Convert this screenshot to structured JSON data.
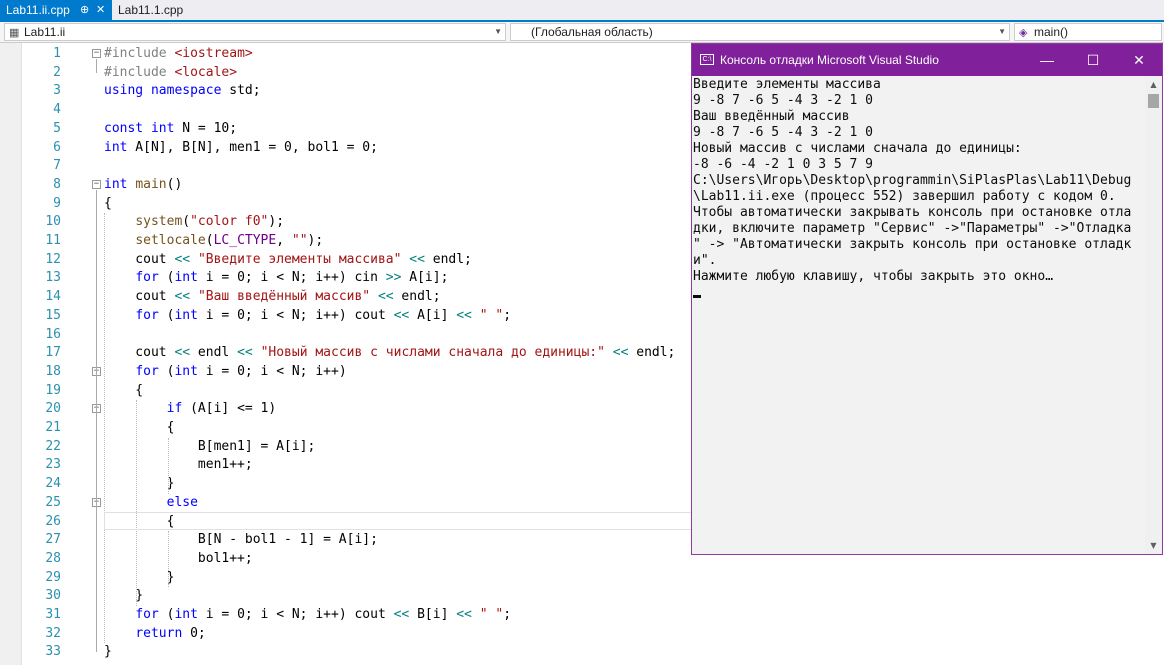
{
  "tabs": [
    {
      "label": "Lab11.ii.cpp",
      "active": true
    },
    {
      "label": "Lab11.1.cpp",
      "active": false
    }
  ],
  "tab_icons": {
    "pin": "⊕",
    "close": "✕"
  },
  "navbar": {
    "project": "Lab11.ii",
    "scope": "(Глобальная область)",
    "member": "main()"
  },
  "code_lines": [
    {
      "n": "1",
      "tokens": [
        [
          "pp",
          "#include "
        ],
        [
          "str",
          "<iostream>"
        ]
      ]
    },
    {
      "n": "2",
      "tokens": [
        [
          "pp",
          "#include "
        ],
        [
          "str",
          "<locale>"
        ]
      ]
    },
    {
      "n": "3",
      "tokens": [
        [
          "kw",
          "using"
        ],
        [
          "plain",
          " "
        ],
        [
          "kw",
          "namespace"
        ],
        [
          "plain",
          " std;"
        ]
      ]
    },
    {
      "n": "4",
      "tokens": []
    },
    {
      "n": "5",
      "tokens": [
        [
          "kw",
          "const"
        ],
        [
          "plain",
          " "
        ],
        [
          "kw",
          "int"
        ],
        [
          "plain",
          " N = 10;"
        ]
      ]
    },
    {
      "n": "6",
      "tokens": [
        [
          "kw",
          "int"
        ],
        [
          "plain",
          " A[N], B[N], men1 = 0, bol1 = 0;"
        ]
      ]
    },
    {
      "n": "7",
      "tokens": []
    },
    {
      "n": "8",
      "tokens": [
        [
          "kw",
          "int"
        ],
        [
          "plain",
          " "
        ],
        [
          "fn",
          "main"
        ],
        [
          "plain",
          "()"
        ]
      ]
    },
    {
      "n": "9",
      "tokens": [
        [
          "plain",
          "{"
        ]
      ]
    },
    {
      "n": "10",
      "tokens": [
        [
          "plain",
          "    "
        ],
        [
          "fn",
          "system"
        ],
        [
          "plain",
          "("
        ],
        [
          "str",
          "\"color f0\""
        ],
        [
          "plain",
          ");"
        ]
      ]
    },
    {
      "n": "11",
      "tokens": [
        [
          "plain",
          "    "
        ],
        [
          "fn",
          "setlocale"
        ],
        [
          "plain",
          "("
        ],
        [
          "mac",
          "LC_CTYPE"
        ],
        [
          "plain",
          ", "
        ],
        [
          "str",
          "\"\""
        ],
        [
          "plain",
          ");"
        ]
      ]
    },
    {
      "n": "12",
      "tokens": [
        [
          "plain",
          "    cout "
        ],
        [
          "op",
          "<<"
        ],
        [
          "plain",
          " "
        ],
        [
          "str",
          "\"Введите элементы массива\""
        ],
        [
          "plain",
          " "
        ],
        [
          "op",
          "<<"
        ],
        [
          "plain",
          " endl;"
        ]
      ]
    },
    {
      "n": "13",
      "tokens": [
        [
          "plain",
          "    "
        ],
        [
          "kw",
          "for"
        ],
        [
          "plain",
          " ("
        ],
        [
          "kw",
          "int"
        ],
        [
          "plain",
          " i = 0; i < N; i++) cin "
        ],
        [
          "op",
          ">>"
        ],
        [
          "plain",
          " A[i];"
        ]
      ]
    },
    {
      "n": "14",
      "tokens": [
        [
          "plain",
          "    cout "
        ],
        [
          "op",
          "<<"
        ],
        [
          "plain",
          " "
        ],
        [
          "str",
          "\"Ваш введённый массив\""
        ],
        [
          "plain",
          " "
        ],
        [
          "op",
          "<<"
        ],
        [
          "plain",
          " endl;"
        ]
      ]
    },
    {
      "n": "15",
      "tokens": [
        [
          "plain",
          "    "
        ],
        [
          "kw",
          "for"
        ],
        [
          "plain",
          " ("
        ],
        [
          "kw",
          "int"
        ],
        [
          "plain",
          " i = 0; i < N; i++) cout "
        ],
        [
          "op",
          "<<"
        ],
        [
          "plain",
          " A[i] "
        ],
        [
          "op",
          "<<"
        ],
        [
          "plain",
          " "
        ],
        [
          "str",
          "\" \""
        ],
        [
          "plain",
          ";"
        ]
      ]
    },
    {
      "n": "16",
      "tokens": []
    },
    {
      "n": "17",
      "tokens": [
        [
          "plain",
          "    cout "
        ],
        [
          "op",
          "<<"
        ],
        [
          "plain",
          " endl "
        ],
        [
          "op",
          "<<"
        ],
        [
          "plain",
          " "
        ],
        [
          "str",
          "\"Новый массив с числами сначала до единицы:\""
        ],
        [
          "plain",
          " "
        ],
        [
          "op",
          "<<"
        ],
        [
          "plain",
          " endl;"
        ]
      ]
    },
    {
      "n": "18",
      "tokens": [
        [
          "plain",
          "    "
        ],
        [
          "kw",
          "for"
        ],
        [
          "plain",
          " ("
        ],
        [
          "kw",
          "int"
        ],
        [
          "plain",
          " i = 0; i < N; i++)"
        ]
      ]
    },
    {
      "n": "19",
      "tokens": [
        [
          "plain",
          "    {"
        ]
      ]
    },
    {
      "n": "20",
      "tokens": [
        [
          "plain",
          "        "
        ],
        [
          "kw",
          "if"
        ],
        [
          "plain",
          " (A[i] <= 1)"
        ]
      ]
    },
    {
      "n": "21",
      "tokens": [
        [
          "plain",
          "        {"
        ]
      ]
    },
    {
      "n": "22",
      "tokens": [
        [
          "plain",
          "            B[men1] = A[i];"
        ]
      ]
    },
    {
      "n": "23",
      "tokens": [
        [
          "plain",
          "            men1++;"
        ]
      ]
    },
    {
      "n": "24",
      "tokens": [
        [
          "plain",
          "        }"
        ]
      ]
    },
    {
      "n": "25",
      "tokens": [
        [
          "plain",
          "        "
        ],
        [
          "kw",
          "else"
        ]
      ]
    },
    {
      "n": "26",
      "tokens": [
        [
          "plain",
          "        {"
        ]
      ]
    },
    {
      "n": "27",
      "tokens": [
        [
          "plain",
          "            B[N - bol1 - 1] = A[i];"
        ]
      ]
    },
    {
      "n": "28",
      "tokens": [
        [
          "plain",
          "            bol1++;"
        ]
      ]
    },
    {
      "n": "29",
      "tokens": [
        [
          "plain",
          "        }"
        ]
      ]
    },
    {
      "n": "30",
      "tokens": [
        [
          "plain",
          "    }"
        ]
      ]
    },
    {
      "n": "31",
      "tokens": [
        [
          "plain",
          "    "
        ],
        [
          "kw",
          "for"
        ],
        [
          "plain",
          " ("
        ],
        [
          "kw",
          "int"
        ],
        [
          "plain",
          " i = 0; i < N; i++) cout "
        ],
        [
          "op",
          "<<"
        ],
        [
          "plain",
          " B[i] "
        ],
        [
          "op",
          "<<"
        ],
        [
          "plain",
          " "
        ],
        [
          "str",
          "\" \""
        ],
        [
          "plain",
          ";"
        ]
      ]
    },
    {
      "n": "32",
      "tokens": [
        [
          "plain",
          "    "
        ],
        [
          "kw",
          "return"
        ],
        [
          "plain",
          " 0;"
        ]
      ]
    },
    {
      "n": "33",
      "tokens": [
        [
          "plain",
          "}"
        ]
      ]
    }
  ],
  "console": {
    "title": "Консоль отладки Microsoft Visual Studio",
    "icon_glyph": "C:\\",
    "buttons": {
      "minimize": "—",
      "maximize": "☐",
      "close": "✕"
    },
    "scroll_up": "▲",
    "scroll_down": "▼",
    "lines": [
      "Введите элементы массива",
      "9 -8 7 -6 5 -4 3 -2 1 0",
      "Ваш введённый массив",
      "9 -8 7 -6 5 -4 3 -2 1 0",
      "Новый массив с числами сначала до единицы:",
      "-8 -6 -4 -2 1 0 3 5 7 9",
      "C:\\Users\\Игорь\\Desktop\\programmin\\SiPlasPlas\\Lab11\\Debug",
      "\\Lab11.ii.exe (процесс 552) завершил работу с кодом 0.",
      "Чтобы автоматически закрывать консоль при остановке отла",
      "дки, включите параметр \"Сервис\" ->\"Параметры\" ->\"Отладка",
      "\" -> \"Автоматически закрыть консоль при остановке отладк",
      "и\".",
      "Нажмите любую клавишу, чтобы закрыть это окно…"
    ]
  },
  "colors": {
    "accent": "#007acc",
    "console_title": "#80209a",
    "keyword": "#0000ff",
    "string": "#a31515",
    "line_number": "#2b91af"
  }
}
